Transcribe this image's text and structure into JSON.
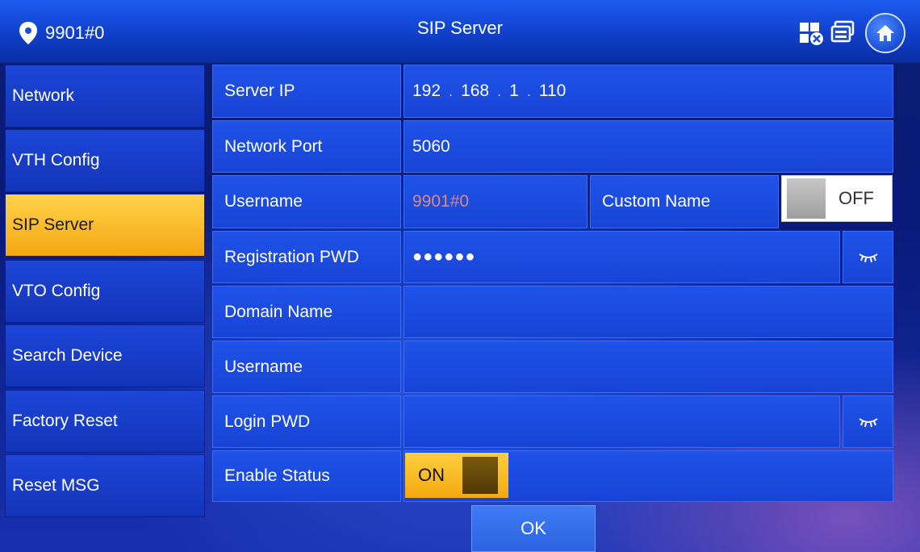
{
  "header": {
    "location": "9901#0",
    "title": "SIP Server",
    "icons": [
      "network-settings-icon",
      "screen-icon",
      "home-icon"
    ]
  },
  "sidebar": {
    "items": [
      {
        "label": "Network"
      },
      {
        "label": "VTH Config"
      },
      {
        "label": "SIP Server",
        "active": true
      },
      {
        "label": "VTO Config"
      },
      {
        "label": "Search Device"
      },
      {
        "label": "Factory Reset"
      },
      {
        "label": "Reset MSG"
      }
    ]
  },
  "form": {
    "server_ip": {
      "label": "Server IP",
      "octets": [
        "192",
        "168",
        "1",
        "110"
      ]
    },
    "network_port": {
      "label": "Network Port",
      "value": "5060"
    },
    "username": {
      "label": "Username",
      "value": "9901#0"
    },
    "custom_name": {
      "label": "Custom Name",
      "toggle": "OFF"
    },
    "registration_pwd": {
      "label": "Registration PWD",
      "value": "●●●●●●"
    },
    "domain_name": {
      "label": "Domain Name",
      "value": ""
    },
    "username2": {
      "label": "Username",
      "value": ""
    },
    "login_pwd": {
      "label": "Login PWD",
      "value": ""
    },
    "enable_status": {
      "label": "Enable Status",
      "toggle": "ON"
    }
  },
  "ok_label": "OK",
  "colors": {
    "accent": "#f4a713",
    "panel": "#1f52e8",
    "header": "#103fc9"
  }
}
